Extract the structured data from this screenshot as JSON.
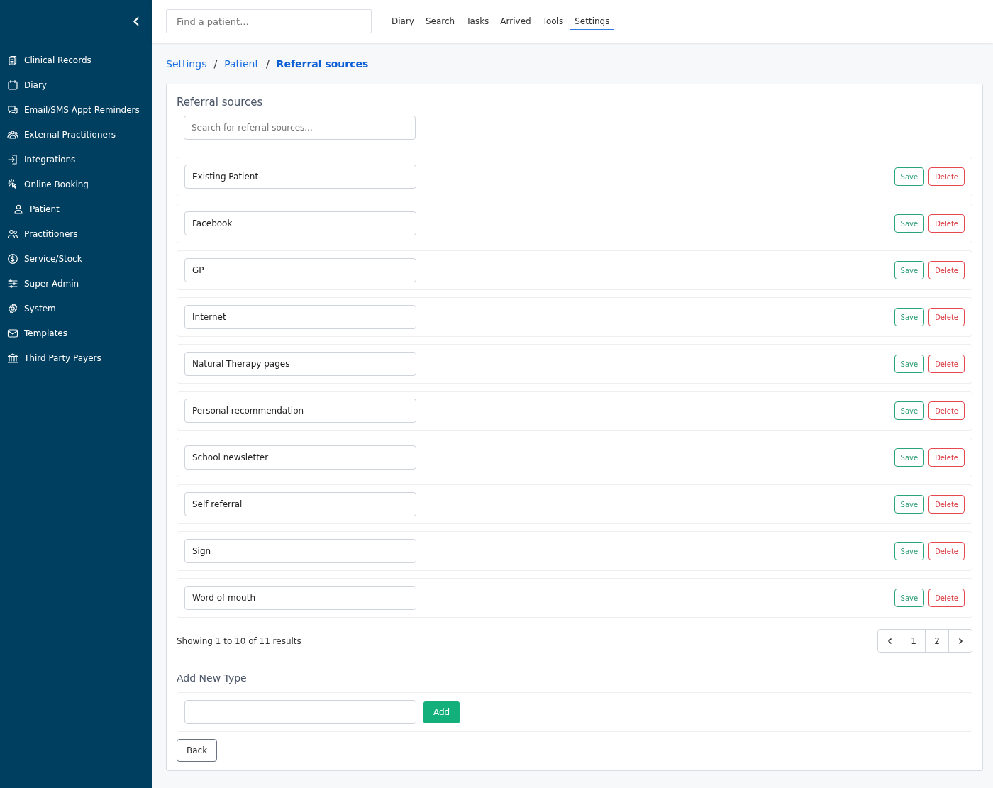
{
  "sidebar": {
    "collapse_icon": "‹",
    "items": [
      {
        "label": "Clinical Records",
        "kind": "link"
      },
      {
        "label": "Diary",
        "kind": "link"
      },
      {
        "label": "Email/SMS Appt Reminders",
        "kind": "link"
      },
      {
        "label": "External Practitioners",
        "kind": "link"
      },
      {
        "label": "Integrations",
        "kind": "link"
      },
      {
        "label": "Online Booking",
        "kind": "link"
      },
      {
        "label": "Patient",
        "kind": "indented"
      },
      {
        "label": "Practitioners",
        "kind": "link"
      },
      {
        "label": "Service/Stock",
        "kind": "link"
      },
      {
        "label": "Super Admin",
        "kind": "link"
      },
      {
        "label": "System",
        "kind": "link"
      },
      {
        "label": "Templates",
        "kind": "link"
      },
      {
        "label": "Third Party Payers",
        "kind": "link"
      }
    ]
  },
  "topbar": {
    "search": {
      "placeholder": "Find a patient..."
    },
    "nav": [
      {
        "label": "Diary",
        "selected": false
      },
      {
        "label": "Search",
        "selected": false
      },
      {
        "label": "Tasks",
        "selected": false
      },
      {
        "label": "Arrived",
        "selected": false
      },
      {
        "label": "Tools",
        "selected": false
      },
      {
        "label": "Settings",
        "selected": true
      }
    ]
  },
  "breadcrumb": [
    {
      "label": "Settings",
      "current": false
    },
    {
      "label": "Patient",
      "current": false
    },
    {
      "label": "Referral sources",
      "current": true
    }
  ],
  "breadcrumb_separator": "/",
  "panel": {
    "title": "Referral sources",
    "search": {
      "placeholder": "Search for referral sources..."
    },
    "rows": [
      {
        "value": "Existing Patient",
        "save": "Save",
        "delete": "Delete"
      },
      {
        "value": "Facebook",
        "save": "Save",
        "delete": "Delete"
      },
      {
        "value": "GP",
        "save": "Save",
        "delete": "Delete"
      },
      {
        "value": "Internet",
        "save": "Save",
        "delete": "Delete"
      },
      {
        "value": "Natural Therapy pages",
        "save": "Save",
        "delete": "Delete"
      },
      {
        "value": "Personal recommendation",
        "save": "Save",
        "delete": "Delete"
      },
      {
        "value": "School newsletter",
        "save": "Save",
        "delete": "Delete"
      },
      {
        "value": "Self referral",
        "save": "Save",
        "delete": "Delete"
      },
      {
        "value": "Sign",
        "save": "Save",
        "delete": "Delete"
      },
      {
        "value": "Word of mouth",
        "save": "Save",
        "delete": "Delete"
      }
    ],
    "summary": "Showing 1 to 10 of 11 results",
    "pagination": {
      "pages": [
        "1",
        "2"
      ]
    },
    "add_title": "Add New Type",
    "add_button": "Add",
    "back_button": "Back"
  }
}
